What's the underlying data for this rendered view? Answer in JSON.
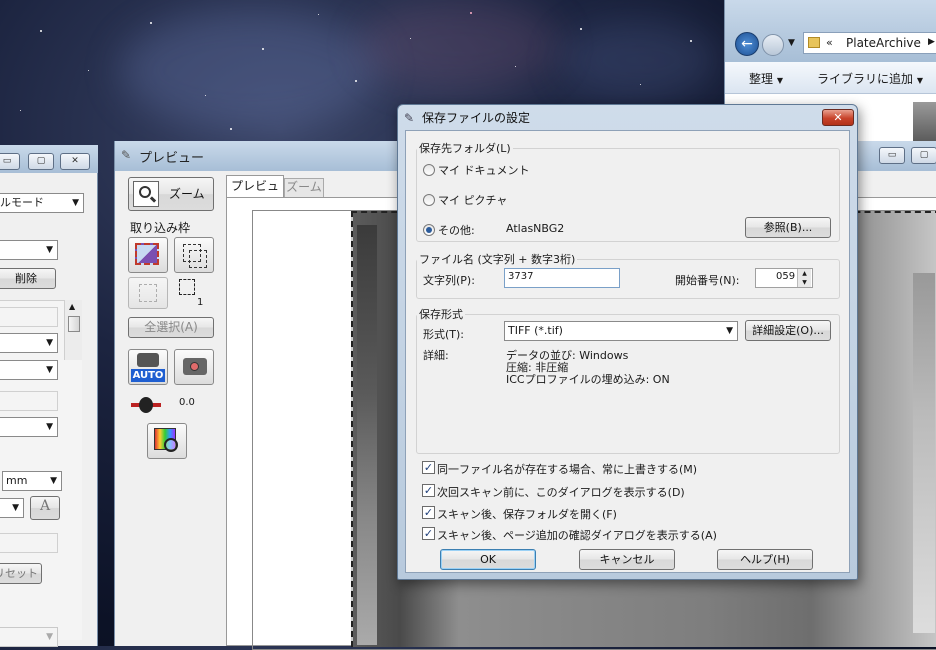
{
  "explorer": {
    "breadcrumb_prefix": "«",
    "breadcrumb": "PlateArchive",
    "toolbar": {
      "organize": "整理",
      "add_to_library": "ライブラリに追加"
    }
  },
  "left_panel": {
    "mode_select": "ルモード",
    "delete_button": "削除",
    "unit_select": "mm",
    "reset_button": "リセット",
    "text_icon": "A"
  },
  "preview": {
    "title": "プレビュー",
    "zoom_button": "ズーム",
    "marquee_label": "取り込み枠",
    "marquee_count": "1",
    "select_all": "全選択(A)",
    "auto_label": "AUTO",
    "exposure_value": "0.0",
    "tabs": [
      {
        "label": "プレビュー"
      },
      {
        "label": "ズーム"
      }
    ]
  },
  "dialog": {
    "title": "保存ファイルの設定",
    "close_glyph": "✕",
    "folder_group": {
      "title": "保存先フォルダ(L)",
      "options": [
        {
          "label": "マイ ドキュメント",
          "selected": false
        },
        {
          "label": "マイ ピクチャ",
          "selected": false
        },
        {
          "label": "その他:",
          "selected": true
        }
      ],
      "other_path": "AtlasNBG2",
      "browse_button": "参照(B)..."
    },
    "filename_group": {
      "title": "ファイル名 (文字列 + 数字3桁)",
      "prefix_label": "文字列(P):",
      "prefix_value": "3737",
      "start_label": "開始番号(N):",
      "start_value": "059"
    },
    "format_group": {
      "title": "保存形式",
      "format_label": "形式(T):",
      "format_value": "TIFF (*.tif)",
      "options_button": "詳細設定(O)...",
      "details_label": "詳細:",
      "details": [
        "データの並び: Windows",
        "圧縮: 非圧縮",
        "ICCプロファイルの埋め込み: ON"
      ]
    },
    "checkboxes": [
      {
        "label": "同一ファイル名が存在する場合、常に上書きする(M)",
        "checked": true
      },
      {
        "label": "次回スキャン前に、このダイアログを表示する(D)",
        "checked": true
      },
      {
        "label": "スキャン後、保存フォルダを開く(F)",
        "checked": true
      },
      {
        "label": "スキャン後、ページ追加の確認ダイアログを表示する(A)",
        "checked": true
      }
    ],
    "buttons": {
      "ok": "OK",
      "cancel": "キャンセル",
      "help": "ヘルプ(H)"
    }
  },
  "colors": {
    "accent": "#3a6ea5",
    "close_red": "#c0392b",
    "dialog_border": "#6f86a0"
  }
}
